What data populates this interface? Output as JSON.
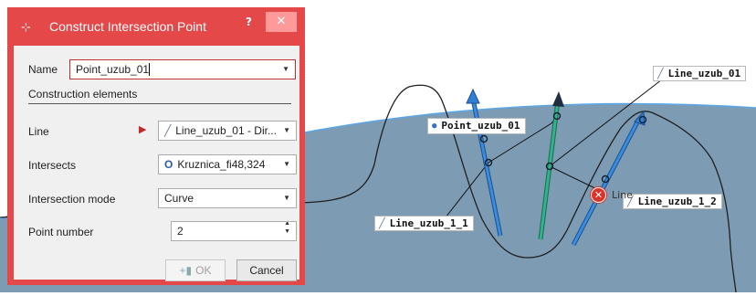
{
  "dialog": {
    "title": "Construct Intersection Point",
    "help_label": "?",
    "close_label": "✕",
    "name_label": "Name",
    "name_value": "Point_uzub_01",
    "section_title": "Construction elements",
    "line_label": "Line",
    "line_value": "Line_uzub_01 - Dir...",
    "intersects_label": "Intersects",
    "intersects_value": "Kruznica_fi48,324",
    "mode_label": "Intersection mode",
    "mode_value": "Curve",
    "point_number_label": "Point number",
    "point_number_value": "2",
    "ok_label": "OK",
    "cancel_label": "Cancel"
  },
  "viewport": {
    "labels": {
      "point_uzub_01": "Point_uzub_01",
      "line_uzub_01": "Line_uzub_01",
      "line_uzub_1_1": "Line_uzub_1_1",
      "line_uzub_1_2": "Line_uzub_1_2",
      "line_hover": "Line"
    },
    "colors": {
      "disk_fill": "#7d9bb3",
      "vector_blue": "#2f7fd4",
      "vector_green": "#2aa57e",
      "dialog_frame": "#e44848",
      "error": "#d9332b"
    },
    "icons": {
      "line": "line-icon",
      "point": "point-icon",
      "circle": "circle-icon",
      "error": "error-icon"
    }
  }
}
